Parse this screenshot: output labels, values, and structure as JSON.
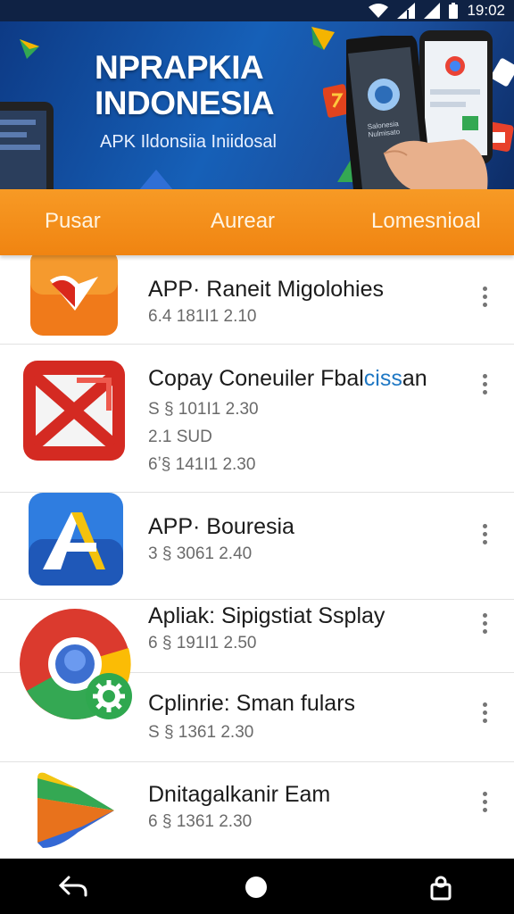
{
  "status_bar": {
    "time": "19:02",
    "icons": [
      "wifi-icon",
      "signal-icon",
      "signal-icon",
      "battery-icon"
    ]
  },
  "banner": {
    "title_line1": "NPRAPKIA",
    "title_line2": "INDONESIA",
    "subtitle": "APK Ildonsiia Iniidosal",
    "phone_screen_caption": "Salonesia Nulmisato"
  },
  "tabs": [
    "Pusar",
    "Aurear",
    "Lomesnioal"
  ],
  "apps": [
    {
      "name": "APP· Raneit Migolohies",
      "meta": [
        "6.4  181I1  2.10"
      ],
      "icon": "orange-red-ribbon-icon"
    },
    {
      "name_main": "Copay Coneuiler Fbal",
      "name_accent": "ciss",
      "name_tail": "an",
      "meta": [
        "S §  101I1  2.30",
        "2.1  SUD",
        "6ʼ§  141I1  2.30"
      ],
      "icon": "red-x-icon"
    },
    {
      "name": "APP· Bouresia",
      "meta": [
        "3 §  3061  2.40"
      ],
      "icon": "blue-a-icon"
    },
    {
      "name": "Apliak: Sipigstiat Ssplay",
      "meta": [
        "6 §  191I1  2.50"
      ],
      "icon": "chrome-gear-icon"
    },
    {
      "name": "Cplinrie: Sman fulars",
      "meta": [
        "S §  1361  2.30"
      ],
      "icon": "chrome-gear-icon"
    },
    {
      "name": "Dnitagalkanir Eam",
      "meta": [
        "6 §  1361  2.30"
      ],
      "icon": "play-triangle-icon"
    }
  ],
  "colors": {
    "status_bar": "#0f2244",
    "banner": "#1660b8",
    "tab_bar": "#f08411",
    "accent_text": "#1f78c4",
    "nav_bar": "#000000"
  },
  "nav_bar": [
    "back-icon",
    "home-icon",
    "recents-icon"
  ]
}
